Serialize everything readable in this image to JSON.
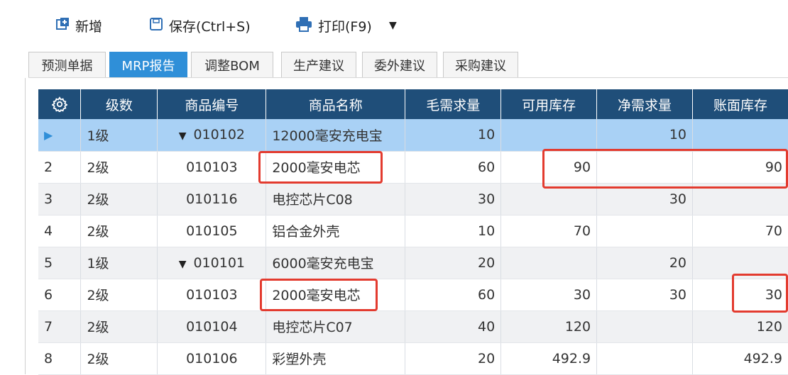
{
  "toolbar": {
    "new_label": "新增",
    "save_label": "保存(Ctrl+S)",
    "print_label": "打印(F9)"
  },
  "tabs": [
    {
      "label": "预测单据",
      "active": false
    },
    {
      "label": "MRP报告",
      "active": true
    },
    {
      "label": "调整BOM",
      "active": false
    },
    {
      "label": "生产建议",
      "active": false
    },
    {
      "label": "委外建议",
      "active": false
    },
    {
      "label": "采购建议",
      "active": false
    }
  ],
  "grid": {
    "headers": {
      "level": "级数",
      "code": "商品编号",
      "name": "商品名称",
      "gross": "毛需求量",
      "available": "可用库存",
      "net": "净需求量",
      "book": "账面库存"
    },
    "rows": [
      {
        "idx": "",
        "level": "1级",
        "code": "010102",
        "name": "12000毫安充电宝",
        "gross": "10",
        "available": "",
        "net": "10",
        "book": ""
      },
      {
        "idx": "2",
        "level": "2级",
        "code": "010103",
        "name": "2000毫安电芯",
        "gross": "60",
        "available": "90",
        "net": "",
        "book": "90"
      },
      {
        "idx": "3",
        "level": "2级",
        "code": "010116",
        "name": "电控芯片C08",
        "gross": "30",
        "available": "",
        "net": "30",
        "book": ""
      },
      {
        "idx": "4",
        "level": "2级",
        "code": "010105",
        "name": "铝合金外壳",
        "gross": "10",
        "available": "70",
        "net": "",
        "book": "70"
      },
      {
        "idx": "5",
        "level": "1级",
        "code": "010101",
        "name": "6000毫安充电宝",
        "gross": "20",
        "available": "",
        "net": "20",
        "book": ""
      },
      {
        "idx": "6",
        "level": "2级",
        "code": "010103",
        "name": "2000毫安电芯",
        "gross": "60",
        "available": "30",
        "net": "30",
        "book": "30"
      },
      {
        "idx": "7",
        "level": "2级",
        "code": "010104",
        "name": "电控芯片C07",
        "gross": "40",
        "available": "120",
        "net": "",
        "book": "120"
      },
      {
        "idx": "8",
        "level": "2级",
        "code": "010106",
        "name": "彩塑外壳",
        "gross": "20",
        "available": "492.9",
        "net": "",
        "book": "492.9"
      }
    ]
  },
  "icons": {
    "new": "plus-square-icon",
    "save": "floppy-icon",
    "print": "printer-icon",
    "dropdown": "caret-down-icon",
    "settings": "gear-icon",
    "current_row": "play-marker-icon",
    "expand": "caret-down-icon"
  },
  "colors": {
    "header_bg": "#1f4e79",
    "active_tab": "#2f8fd8",
    "selected_row": "#a9d1f5",
    "highlight_box": "#e33b2f"
  }
}
